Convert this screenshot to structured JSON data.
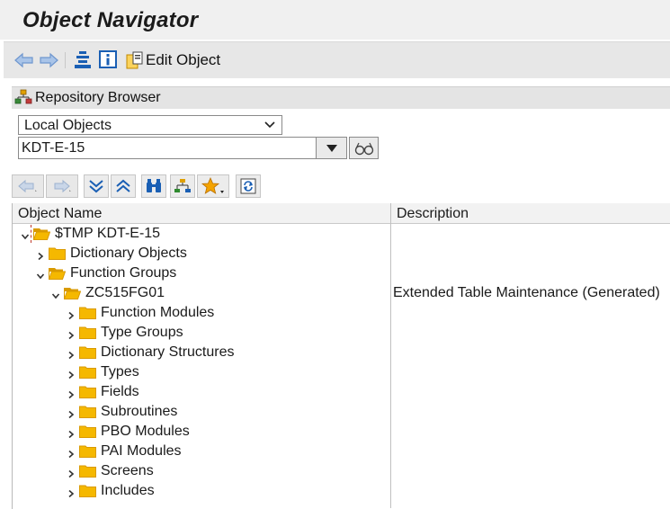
{
  "window": {
    "title": "Object Navigator"
  },
  "toolbar": {
    "back_icon": "back-arrow-icon",
    "forward_icon": "forward-arrow-icon",
    "hierarchy_icon": "hierarchy-icon",
    "info_icon": "info-icon",
    "edit_object_label": "Edit Object"
  },
  "repository_browser": {
    "header_label": "Repository Browser",
    "object_type": {
      "selected": "Local Objects"
    },
    "package": {
      "value": "KDT-E-15"
    }
  },
  "tree": {
    "columns": {
      "name": "Object Name",
      "description": "Description"
    },
    "rows": [
      {
        "label": "$TMP KDT-E-15",
        "description": "",
        "expanded": true
      },
      {
        "label": "Dictionary Objects",
        "description": "",
        "expanded": false
      },
      {
        "label": "Function Groups",
        "description": "",
        "expanded": true
      },
      {
        "label": "ZC515FG01",
        "description": "Extended Table Maintenance (Generated)",
        "expanded": true
      },
      {
        "label": "Function Modules",
        "description": "",
        "expanded": false
      },
      {
        "label": "Type Groups",
        "description": "",
        "expanded": false
      },
      {
        "label": "Dictionary Structures",
        "description": "",
        "expanded": false
      },
      {
        "label": "Types",
        "description": "",
        "expanded": false
      },
      {
        "label": "Fields",
        "description": "",
        "expanded": false
      },
      {
        "label": "Subroutines",
        "description": "",
        "expanded": false
      },
      {
        "label": "PBO Modules",
        "description": "",
        "expanded": false
      },
      {
        "label": "PAI Modules",
        "description": "",
        "expanded": false
      },
      {
        "label": "Screens",
        "description": "",
        "expanded": false
      },
      {
        "label": "Includes",
        "description": "",
        "expanded": false
      }
    ]
  },
  "colors": {
    "folder": "#f5b800",
    "folder_dark": "#d99a00",
    "nav_arrow": "#7fa4d6",
    "icon_blue": "#1a5fb4",
    "toolbar_bg": "#e7e7e7"
  }
}
